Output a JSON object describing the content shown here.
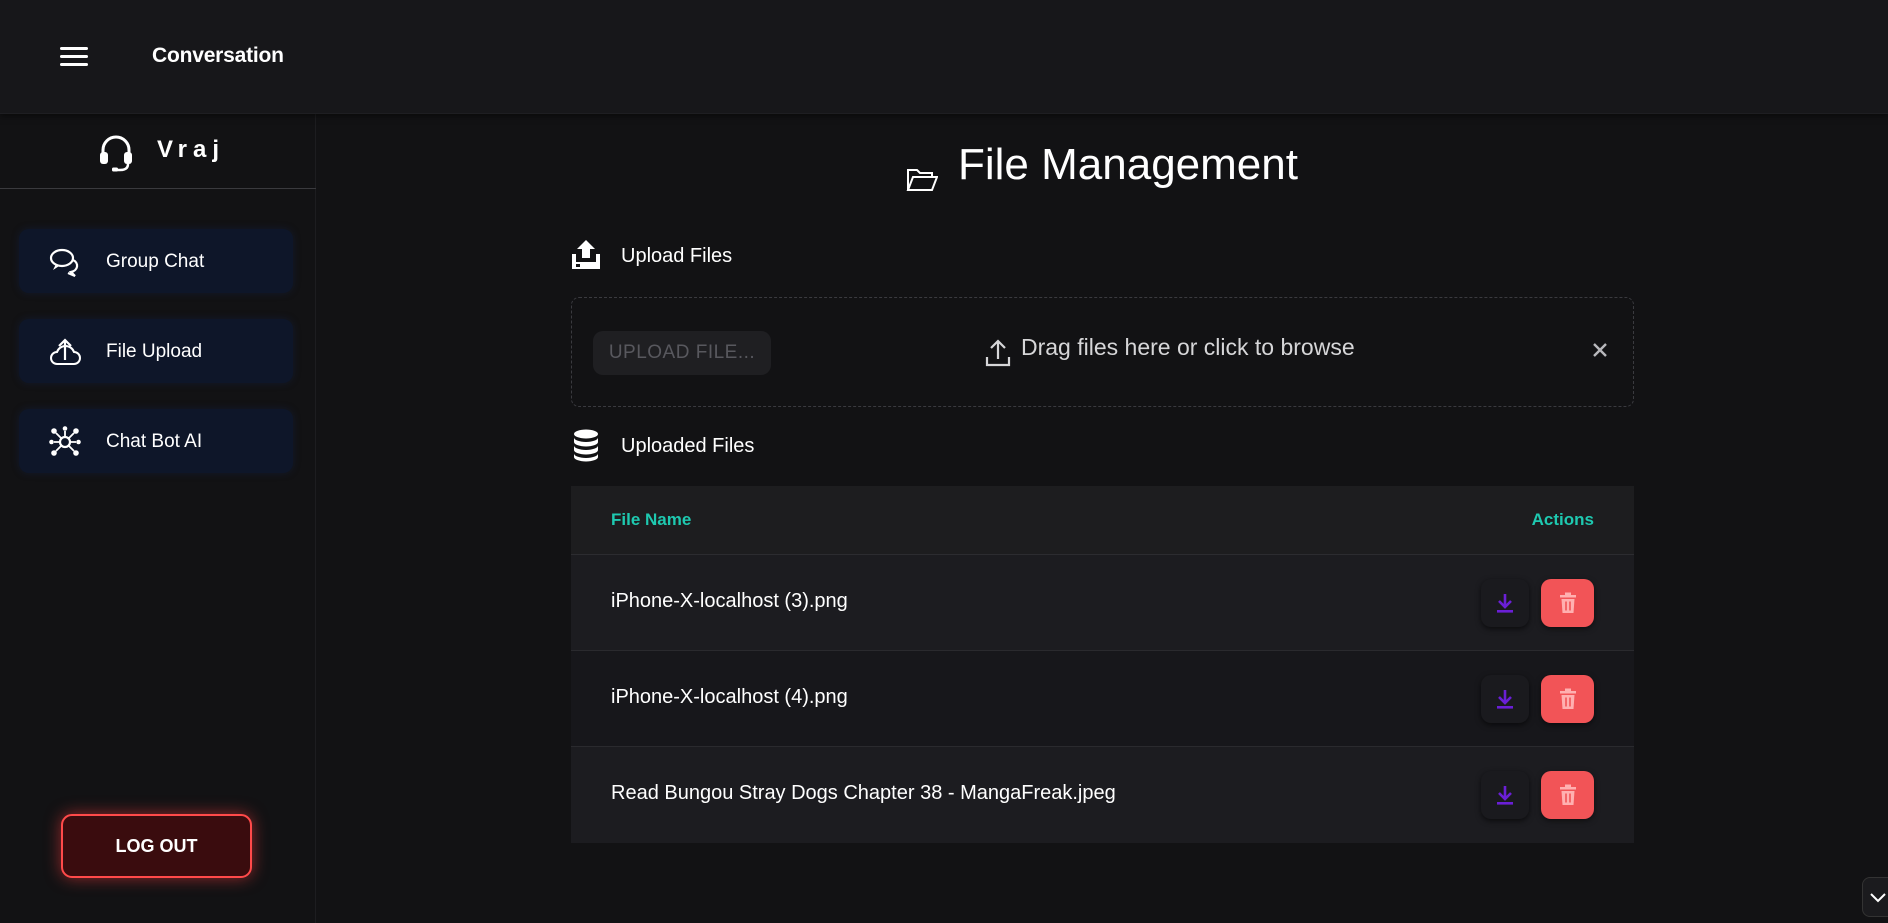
{
  "header": {
    "title": "Conversation",
    "menu_icon": "hamburger-menu-icon"
  },
  "sidebar": {
    "profile": {
      "name": "Vraj",
      "icon": "headset-icon"
    },
    "items": [
      {
        "label": "Group Chat",
        "icon": "chat-bubbles-icon"
      },
      {
        "label": "File Upload",
        "icon": "cloud-upload-icon"
      },
      {
        "label": "Chat Bot AI",
        "icon": "network-hub-icon"
      }
    ],
    "logout_label": "LOG OUT"
  },
  "main": {
    "title": "File Management",
    "title_icon": "folder-open-icon",
    "upload_section": {
      "label": "Upload Files",
      "icon": "upload-tray-icon",
      "button_label": "UPLOAD FILE...",
      "drop_text": "Drag files here or click to browse",
      "drop_icon": "upload-arrow-icon",
      "clear_icon": "close-icon"
    },
    "files_section": {
      "label": "Uploaded Files",
      "icon": "database-icon",
      "columns": [
        "File Name",
        "Actions"
      ],
      "rows": [
        {
          "name": "iPhone-X-localhost (3).png"
        },
        {
          "name": "iPhone-X-localhost (4).png"
        },
        {
          "name": "Read Bungou Stray Dogs Chapter 38 - MangaFreak.jpeg"
        }
      ],
      "download_icon": "download-icon",
      "delete_icon": "trash-icon"
    }
  },
  "colors": {
    "accent_teal": "#1ec9b0",
    "download_purple": "#6a1fd6",
    "delete_red": "#f25457",
    "logout_border": "#ff4a4a",
    "nav_bg": "#0e1629"
  }
}
